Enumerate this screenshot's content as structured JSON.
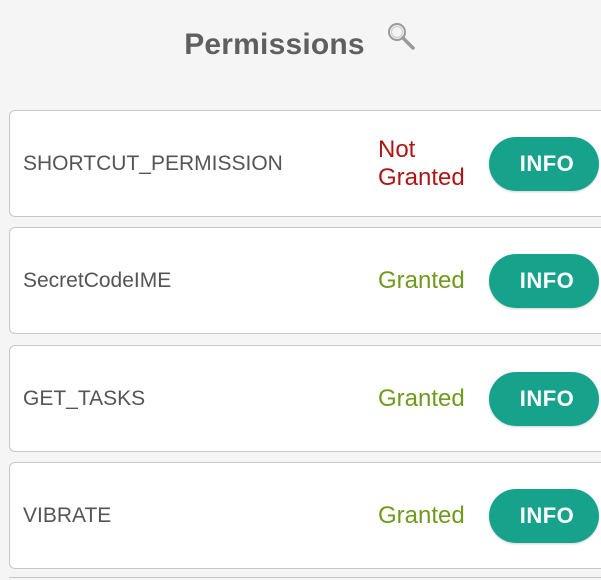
{
  "header": {
    "title": "Permissions",
    "search_icon": "search-icon"
  },
  "permissions": [
    {
      "name": "SHORTCUT_PERMISSION",
      "status": "Not\nGranted",
      "granted": false,
      "button": "INFO"
    },
    {
      "name": "SecretCodeIME",
      "status": "Granted",
      "granted": true,
      "button": "INFO"
    },
    {
      "name": "GET_TASKS",
      "status": "Granted",
      "granted": true,
      "button": "INFO"
    },
    {
      "name": "VIBRATE",
      "status": "Granted",
      "granted": true,
      "button": "INFO"
    }
  ],
  "colors": {
    "background": "#f5f5f5",
    "granted": "#6f9a1c",
    "not_granted": "#b01515",
    "button": "#17a28b"
  }
}
